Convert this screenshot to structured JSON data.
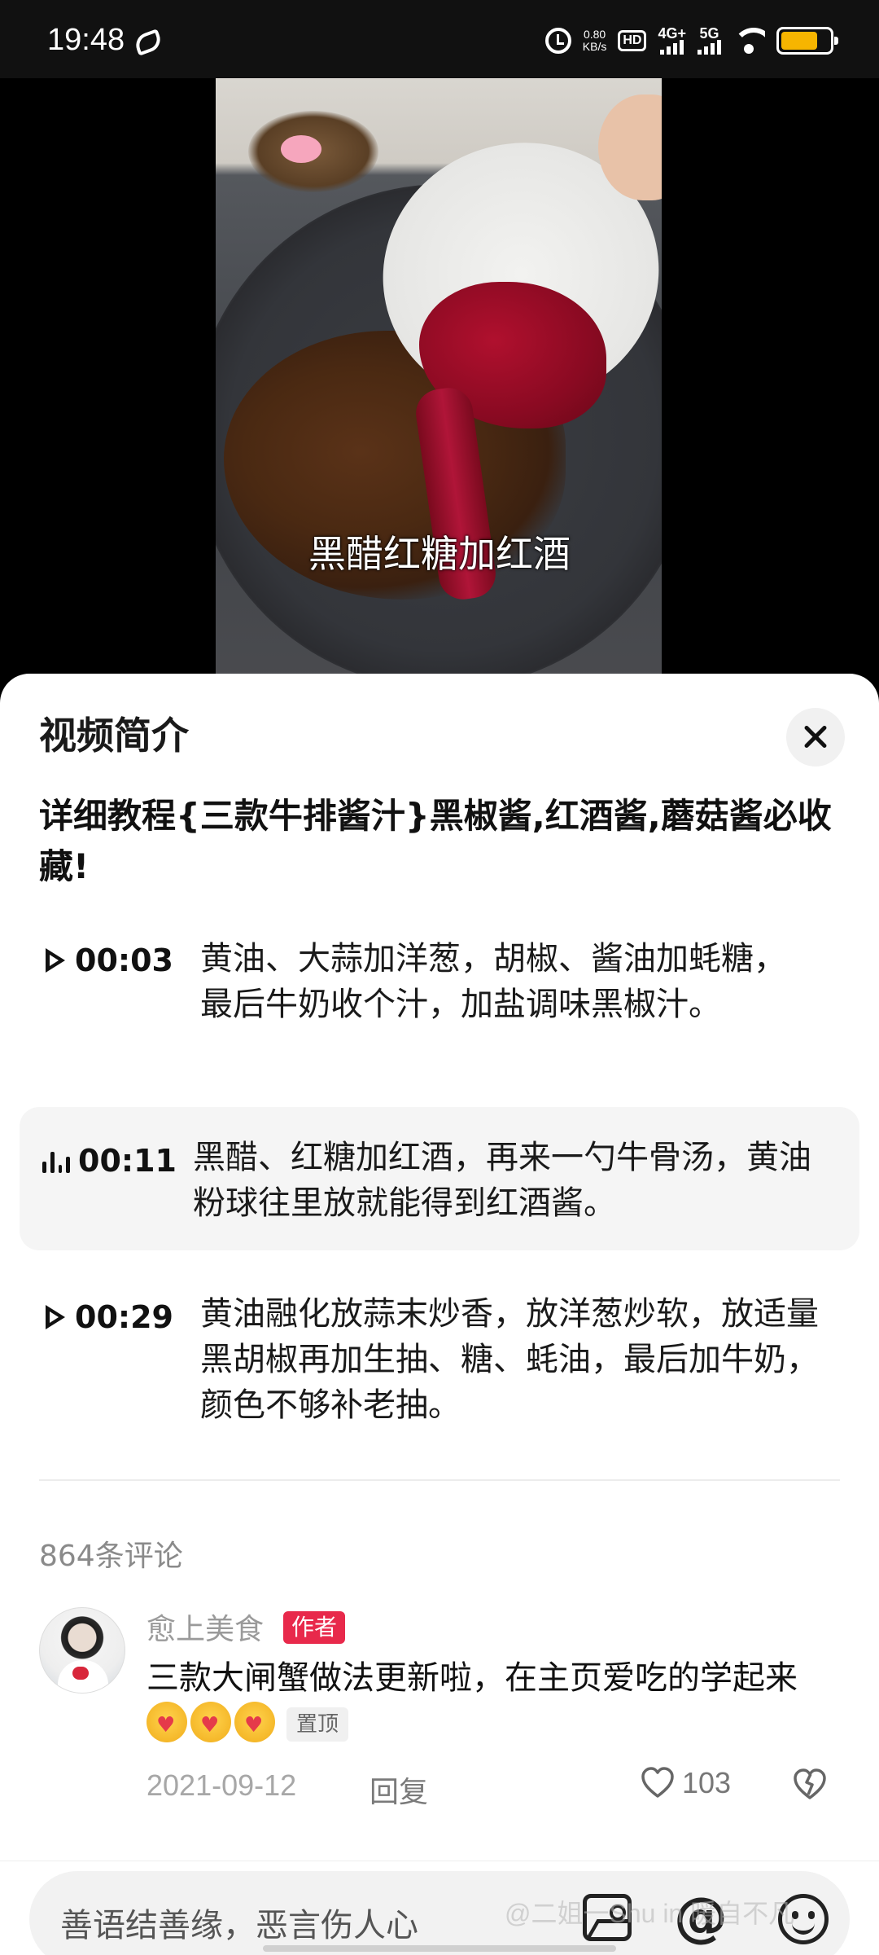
{
  "status_bar": {
    "time": "19:48",
    "net_speed_value": "0.80",
    "net_speed_unit": "KB/s",
    "hd_label": "HD",
    "network_1": "4G+",
    "network_2": "5G",
    "battery_percent": 75,
    "colors": {
      "battery": "#f7b500"
    }
  },
  "video": {
    "subtitle": "黑醋红糖加红酒"
  },
  "sheet": {
    "title": "视频简介",
    "close_icon": "close-icon",
    "video_title": "详细教程{三款牛排酱汁}黑椒酱,红酒酱,蘑菇酱必收藏!",
    "chapters": [
      {
        "time": "00:03",
        "icon": "play-icon",
        "text": "黄油、大蒜加洋葱，胡椒、酱油加蚝糖，最后牛奶收个汁，加盐调味黑椒汁。",
        "active": false
      },
      {
        "time": "00:11",
        "icon": "playing-bars-icon",
        "text": "黑醋、红糖加红酒，再来一勺牛骨汤，黄油粉球往里放就能得到红酒酱。",
        "active": true
      },
      {
        "time": "00:29",
        "icon": "play-icon",
        "text": "黄油融化放蒜末炒香，放洋葱炒软，放适量黑胡椒再加生抽、糖、蚝油，最后加牛奶，颜色不够补老抽。",
        "active": false
      }
    ]
  },
  "comments": {
    "count_label": "864条评论",
    "items": [
      {
        "user": "愈上美食",
        "badge": "作者",
        "text": "三款大闸蟹做法更新啦，在主页爱吃的学起来",
        "pin_label": "置顶",
        "date": "2021-09-12",
        "reply_label": "回复",
        "likes": "103"
      }
    ],
    "colors": {
      "author_badge": "#e8294b"
    }
  },
  "input_bar": {
    "placeholder": "善语结善缘，恶言伤人心",
    "icons": [
      "image-icon",
      "at-icon",
      "emoji-icon"
    ],
    "at_symbol": "@"
  },
  "watermark": "@二姐一Shu in 暖自不凡"
}
